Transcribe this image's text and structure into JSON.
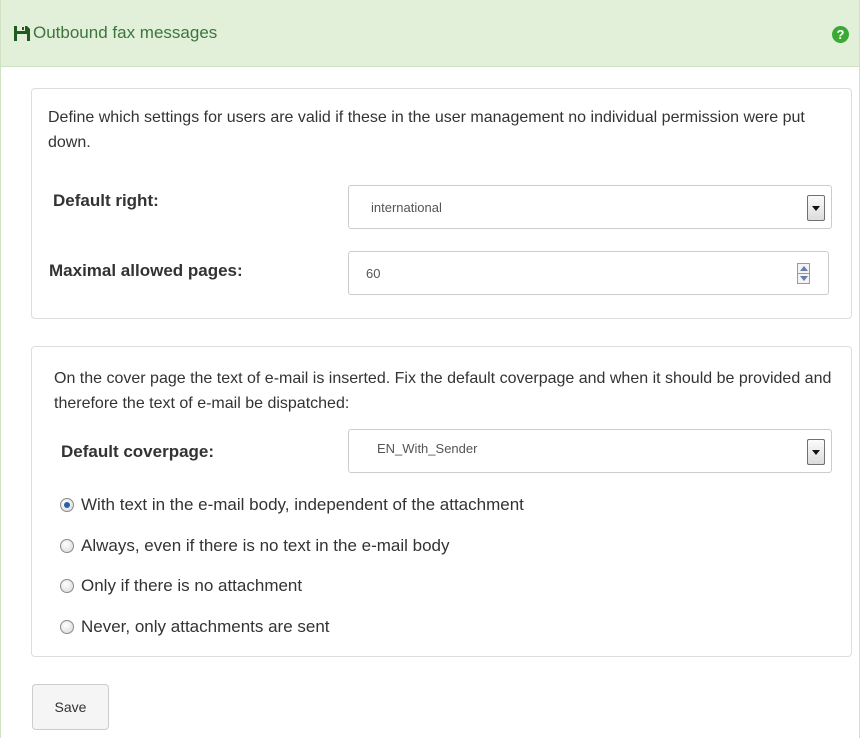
{
  "header": {
    "title": "Outbound fax messages",
    "icon": "save-icon",
    "help_icon": "question-circle-icon",
    "help_glyph": "?"
  },
  "colors": {
    "header_background": "#e2efd9",
    "header_text": "#3c763d",
    "help_icon": "#3aaa35"
  },
  "defaults_section": {
    "description": "Define which settings for users are valid if these in the user management no individual permission were put down.",
    "default_right_label": "Default right:",
    "default_right_value": "international",
    "max_pages_label": "Maximal allowed pages:",
    "max_pages_value": "60"
  },
  "coverpage_section": {
    "description": "On the cover page the text of e-mail is inserted. Fix the default coverpage and when it should be provided and therefore the text of e-mail be dispatched:",
    "default_coverpage_label": "Default coverpage:",
    "default_coverpage_value": "EN_With_Sender",
    "options": [
      {
        "label": "With text in the e-mail body, independent of the attachment",
        "checked": true
      },
      {
        "label": "Always, even if there is no text in the e-mail body",
        "checked": false
      },
      {
        "label": "Only if there is no attachment",
        "checked": false
      },
      {
        "label": "Never, only attachments are sent",
        "checked": false
      }
    ]
  },
  "actions": {
    "save_label": "Save"
  }
}
